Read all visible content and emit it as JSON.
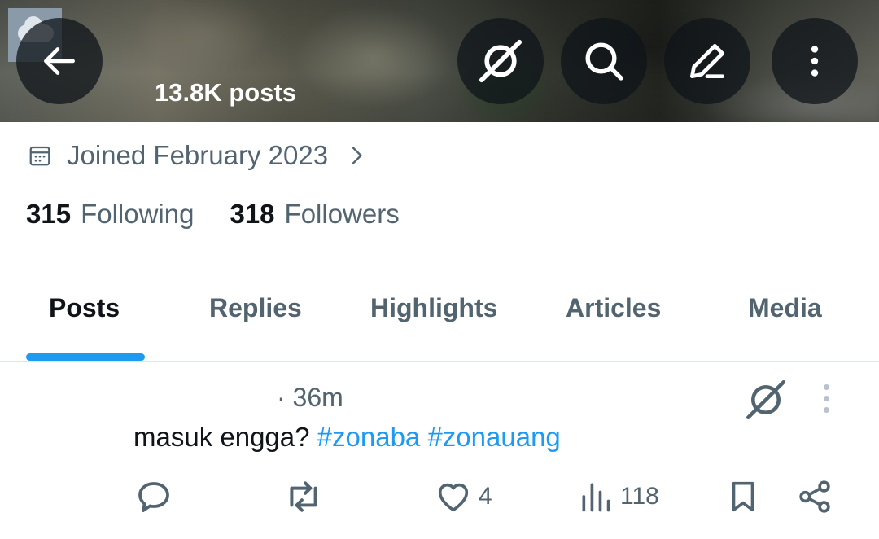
{
  "header": {
    "posts_count": "13.8K posts",
    "icons": [
      "back-arrow-icon",
      "grok-icon",
      "search-icon",
      "edit-icon",
      "more-vertical-icon"
    ]
  },
  "profile": {
    "joined": "Joined February 2023",
    "following_count": "315",
    "following_label": "Following",
    "followers_count": "318",
    "followers_label": "Followers"
  },
  "tabs": [
    {
      "label": "Posts",
      "active": true
    },
    {
      "label": "Replies",
      "active": false
    },
    {
      "label": "Highlights",
      "active": false
    },
    {
      "label": "Articles",
      "active": false
    },
    {
      "label": "Media",
      "active": false
    }
  ],
  "post": {
    "time": "· 36m",
    "text": "masuk engga?",
    "hashtags": [
      "#zonaba",
      "#zonauang"
    ],
    "likes": "4",
    "views": "118"
  },
  "colors": {
    "accent": "#1d9bf0",
    "secondary_text": "#536471",
    "primary_text": "#0f1419"
  }
}
